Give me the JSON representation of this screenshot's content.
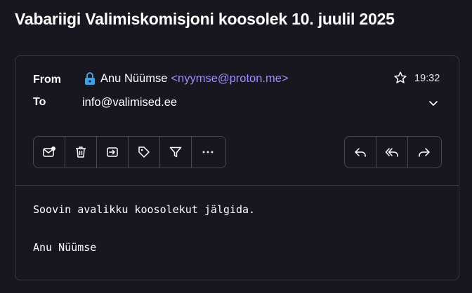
{
  "email": {
    "subject": "Vabariigi Valimiskomisjoni koosolek 10. juulil 2025",
    "from_label": "From",
    "to_label": "To",
    "sender_name": "Anu Nüümse",
    "sender_address": "<nyymse@proton.me>",
    "to_address": "info@valimised.ee",
    "time": "19:32",
    "body_lines": [
      "Soovin avalikku koosolekut jälgida.",
      "Anu Nüümse"
    ]
  },
  "toolbar": {
    "left_icons": [
      "mark-unread-icon",
      "trash-icon",
      "move-icon",
      "tag-icon",
      "filter-icon",
      "more-icon"
    ],
    "right_icons": [
      "reply-icon",
      "reply-all-icon",
      "forward-icon"
    ]
  },
  "colors": {
    "background": "#18161f",
    "border": "#3a3742",
    "accent": "#a48bf5",
    "lock": "#3ea0e6"
  }
}
